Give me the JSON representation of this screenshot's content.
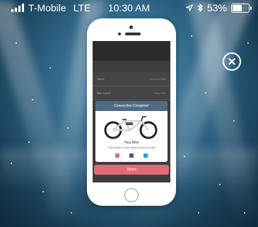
{
  "status_bar": {
    "carrier": "T-Mobile",
    "network": "LTE",
    "time": "10:30 AM",
    "battery": "53%",
    "battery_level": 0.53,
    "location_icon": "location-arrow-icon",
    "bluetooth_icon": "bluetooth-icon"
  },
  "overlay": {
    "close_icon": "close-circle-icon"
  },
  "phone_screen": {
    "app_rows": [
      {
        "label": "Name",
        "value": "Aventon Bike"
      },
      {
        "label": "Bike Name",
        "value": "Pace 500"
      }
    ],
    "modal": {
      "header": "Connection Complete!",
      "title": "Your Bike",
      "message": "This ebike is now linked to your profile",
      "social_icons": [
        "email-icon",
        "facebook-icon",
        "twitter-icon"
      ],
      "social_colors": [
        "#e06b78",
        "#3b5998",
        "#1da1f2"
      ]
    },
    "share_button": "Share"
  }
}
